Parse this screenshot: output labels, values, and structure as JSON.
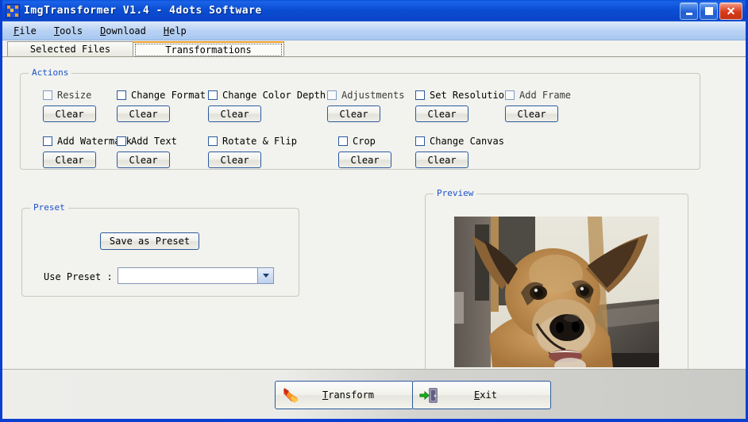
{
  "window": {
    "title": "ImgTransformer V1.4 - 4dots Software",
    "icon": "app-dots-icon",
    "controls": {
      "minimize": "Minimize",
      "maximize": "Maximize",
      "close": "Close"
    },
    "accent_blue": "#0a4fd0",
    "legend_blue": "#1a52c8",
    "tab_active_orange": "#f0a02a"
  },
  "menu": {
    "items": [
      {
        "label": "File",
        "mnemonic": "F"
      },
      {
        "label": "Tools",
        "mnemonic": "T"
      },
      {
        "label": "Download",
        "mnemonic": "D"
      },
      {
        "label": "Help",
        "mnemonic": "H"
      }
    ]
  },
  "tabs": [
    {
      "label": "Selected Files",
      "active": false
    },
    {
      "label": "Transformations",
      "active": true
    }
  ],
  "actions": {
    "legend": "Actions",
    "clear_label": "Clear",
    "row1": [
      {
        "label": "Resize",
        "checked": false,
        "enabled": false
      },
      {
        "label": "Change Format",
        "checked": false,
        "enabled": true
      },
      {
        "label": "Change Color Depth",
        "checked": false,
        "enabled": true
      },
      {
        "label": "Adjustments",
        "checked": false,
        "enabled": false
      },
      {
        "label": "Set Resolution",
        "checked": false,
        "enabled": true
      },
      {
        "label": "Add Frame",
        "checked": false,
        "enabled": false
      }
    ],
    "row2": [
      {
        "label": "Add Watermark",
        "checked": false,
        "enabled": true
      },
      {
        "label": "Add Text",
        "checked": false,
        "enabled": true
      },
      {
        "label": "Rotate & Flip",
        "checked": false,
        "enabled": true
      },
      {
        "label": "Crop",
        "checked": false,
        "enabled": true
      },
      {
        "label": "Change Canvas",
        "checked": false,
        "enabled": true
      }
    ]
  },
  "preset": {
    "legend": "Preset",
    "save_button": "Save as Preset",
    "use_label": "Use Preset :",
    "selected_value": "",
    "placeholder": ""
  },
  "preview": {
    "legend": "Preview",
    "image_description": "Photograph of a tan and brown dog facing the camera with ears up"
  },
  "footer": {
    "transform": {
      "label": "Transform",
      "mnemonic": "T",
      "icon": "flame-arrow-icon"
    },
    "exit": {
      "label": "Exit",
      "mnemonic": "E",
      "icon": "exit-door-icon"
    }
  }
}
